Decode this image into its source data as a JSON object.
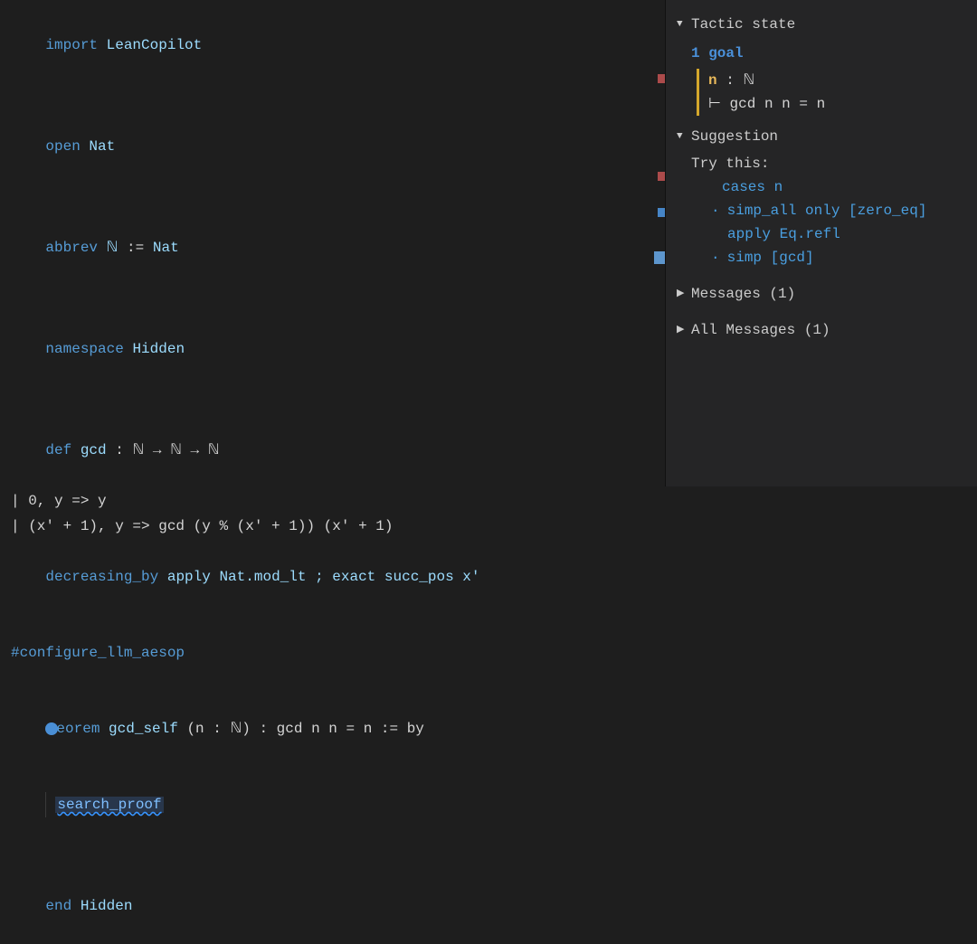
{
  "editor": {
    "lines": {
      "l1_kw": "import",
      "l1_id": "LeanCopilot",
      "l3_kw": "open",
      "l3_id": "Nat",
      "l5_kw": "abbrev",
      "l5_id": "ℕ",
      "l5_op": ":=",
      "l5_rhs": "Nat",
      "l7_kw": "namespace",
      "l7_id": "Hidden",
      "l9_kw": "def",
      "l9_id": "gcd",
      "l9_sig": ": ℕ → ℕ → ℕ",
      "l10": "| 0, y => y",
      "l11": "| (x' + 1), y => gcd (y % (x' + 1)) (x' + 1)",
      "l12_kw": "decreasing_by",
      "l12_rest": "apply Nat.mod_lt ; exact succ_pos x'",
      "l14": "#configure_llm_aesop",
      "l16_kw": "eorem",
      "l16_id": "gcd_self",
      "l16_sig": "(n : ℕ) : gcd n n = n := by",
      "l17": "search_proof",
      "l19_kw": "end",
      "l19_id": "Hidden"
    }
  },
  "panel": {
    "tactic_state_header": "Tactic state",
    "goal_count": "1 goal",
    "hyp": "n : ℕ",
    "hyp_name": "n",
    "hyp_type": ": ℕ",
    "goal_turnstile": "⊢",
    "goal_expr": "gcd n n = n",
    "suggestion_header": "Suggestion",
    "try_this": "Try this:",
    "sug_main": "cases n",
    "sug_b1a": "simp_all only [zero_eq]",
    "sug_b1b": "apply Eq.refl",
    "sug_b2": "simp [gcd]",
    "messages_header": "Messages (1)",
    "all_messages_header": "All Messages (1)"
  }
}
